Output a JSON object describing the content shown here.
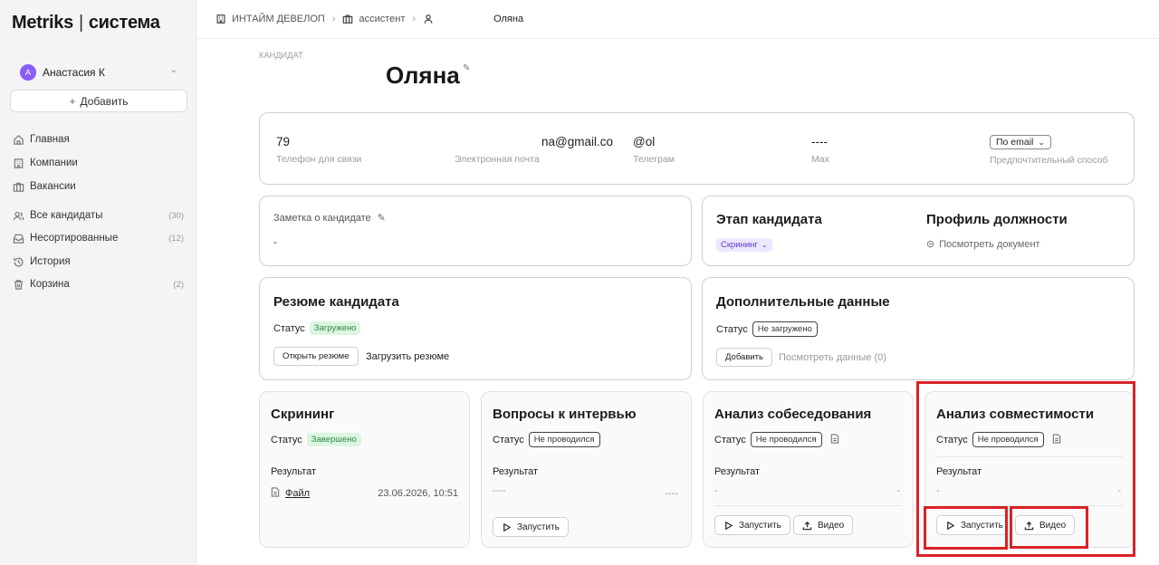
{
  "sidebar": {
    "logo_left": "Metriks",
    "logo_sep": "|",
    "logo_right": "система",
    "user_initial": "А",
    "user_name": "Анастасия К",
    "add_label": "Добавить",
    "items": [
      {
        "label": "Главная",
        "icon": "home-icon",
        "count": ""
      },
      {
        "label": "Компании",
        "icon": "building-icon",
        "count": ""
      },
      {
        "label": "Вакансии",
        "icon": "briefcase-icon",
        "count": ""
      },
      {
        "label": "Все кандидаты",
        "icon": "users-icon",
        "count": "(30)"
      },
      {
        "label": "Несортированные",
        "icon": "inbox-icon",
        "count": "(12)"
      },
      {
        "label": "История",
        "icon": "history-icon",
        "count": ""
      },
      {
        "label": "Корзина",
        "icon": "trash-icon",
        "count": "(2)"
      }
    ]
  },
  "breadcrumb": {
    "company": "ИНТАЙМ ДЕВЕЛОП",
    "vacancy": "ассистент",
    "candidate": "Оляна"
  },
  "header": {
    "label": "КАНДИДАТ",
    "name": "Оляна"
  },
  "contacts": {
    "phone_value": "79",
    "phone_label": "Телефон для связи",
    "email_value": "na@gmail.co",
    "email_label": "Электронная почта",
    "telegram_value": "@ol",
    "telegram_label": "Телеграм",
    "max_value": "----",
    "max_label": "Max",
    "pref_value": "По email",
    "pref_label": "Предпочтительный способ"
  },
  "note": {
    "label": "Заметка о кандидате",
    "value": "-"
  },
  "stage": {
    "title": "Этап кандидата",
    "value": "Скрининг",
    "profile_title": "Профиль должности",
    "profile_link": "Посмотреть документ"
  },
  "resume": {
    "title": "Резюме кандидата",
    "status_label": "Статус",
    "status": "Загружено",
    "open_btn": "Открыть резюме",
    "upload_btn": "Загрузить резюме"
  },
  "extra": {
    "title": "Дополнительные данные",
    "status_label": "Статус",
    "status": "Не загружено",
    "add_btn": "Добавить",
    "view_link": "Посмотреть данные (0)"
  },
  "screening": {
    "title": "Скрининг",
    "status_label": "Статус",
    "status": "Завершено",
    "result_label": "Результат",
    "file_label": "Файл",
    "date": "23.06.2026, 10:51"
  },
  "questions": {
    "title": "Вопросы к интервью",
    "status_label": "Статус",
    "status": "Не проводился",
    "result_label": "Результат",
    "result_left": "----",
    "result_right": "----",
    "run_btn": "Запустить"
  },
  "interview": {
    "title": "Анализ собеседования",
    "status_label": "Статус",
    "status": "Не проводился",
    "result_label": "Результат",
    "result_left": "-",
    "result_right": "-",
    "run_btn": "Запустить",
    "video_btn": "Видео"
  },
  "compat": {
    "title": "Анализ совместимости",
    "status_label": "Статус",
    "status": "Не проводился",
    "result_label": "Результат",
    "result_left": "-",
    "result_right": "-",
    "run_btn": "Запустить",
    "video_btn": "Видео"
  },
  "colors": {
    "highlight": "#d92326",
    "accent_purple": "#8b5cf6",
    "success_green": "#2b8a3e"
  }
}
